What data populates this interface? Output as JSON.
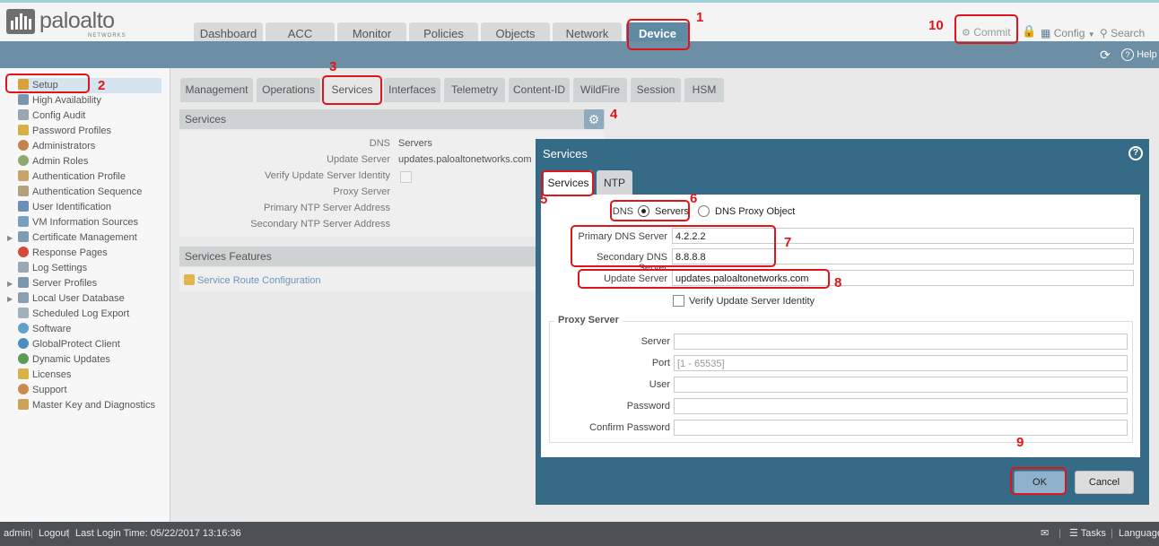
{
  "header": {
    "logo_text": "paloalto",
    "logo_sub": "NETWORKS",
    "tabs": [
      "Dashboard",
      "ACC",
      "Monitor",
      "Policies",
      "Objects",
      "Network",
      "Device"
    ],
    "commit": "Commit",
    "config": "Config",
    "search": "Search",
    "help": "Help"
  },
  "sidebar": {
    "items": [
      "Setup",
      "High Availability",
      "Config Audit",
      "Password Profiles",
      "Administrators",
      "Admin Roles",
      "Authentication Profile",
      "Authentication Sequence",
      "User Identification",
      "VM Information Sources",
      "Certificate Management",
      "Response Pages",
      "Log Settings",
      "Server Profiles",
      "Local User Database",
      "Scheduled Log Export",
      "Software",
      "GlobalProtect Client",
      "Dynamic Updates",
      "Licenses",
      "Support",
      "Master Key and Diagnostics"
    ]
  },
  "subtabs": [
    "Management",
    "Operations",
    "Services",
    "Interfaces",
    "Telemetry",
    "Content-ID",
    "WildFire",
    "Session",
    "HSM"
  ],
  "services_panel": {
    "title": "Services",
    "rows": [
      {
        "label": "DNS",
        "value": "Servers"
      },
      {
        "label": "Update Server",
        "value": "updates.paloaltonetworks.com"
      },
      {
        "label": "Verify Update Server Identity",
        "value": ""
      },
      {
        "label": "Proxy Server",
        "value": ""
      },
      {
        "label": "Primary NTP Server Address",
        "value": ""
      },
      {
        "label": "Secondary NTP Server Address",
        "value": ""
      }
    ]
  },
  "features_panel": {
    "title": "Services Features",
    "link": "Service Route Configuration"
  },
  "modal": {
    "title": "Services",
    "tabs": [
      "Services",
      "NTP"
    ],
    "dns_label": "DNS",
    "dns_servers_option": "Servers",
    "dns_proxy_option": "DNS Proxy Object",
    "primary_dns_label": "Primary DNS Server",
    "primary_dns_value": "4.2.2.2",
    "secondary_dns_label": "Secondary DNS Server",
    "secondary_dns_value": "8.8.8.8",
    "update_server_label": "Update Server",
    "update_server_value": "updates.paloaltonetworks.com",
    "verify_label": "Verify Update Server Identity",
    "proxy_legend": "Proxy Server",
    "proxy_fields": [
      {
        "label": "Server",
        "value": "",
        "placeholder": ""
      },
      {
        "label": "Port",
        "value": "",
        "placeholder": "[1 - 65535]"
      },
      {
        "label": "User",
        "value": "",
        "placeholder": ""
      },
      {
        "label": "Password",
        "value": "",
        "placeholder": ""
      },
      {
        "label": "Confirm Password",
        "value": "",
        "placeholder": ""
      }
    ],
    "ok": "OK",
    "cancel": "Cancel"
  },
  "annotations": [
    "1",
    "2",
    "3",
    "4",
    "5",
    "6",
    "7",
    "8",
    "9",
    "10"
  ],
  "footer": {
    "user": "admin",
    "logout": "Logout",
    "last_login": "Last Login Time: 05/22/2017 13:16:36",
    "tasks": "Tasks",
    "language": "Language"
  },
  "colors": {
    "brand_blue": "#366b87",
    "toolstrip": "#6c8fa6",
    "annotation_red": "#e0141b",
    "footer": "#4e5154"
  }
}
